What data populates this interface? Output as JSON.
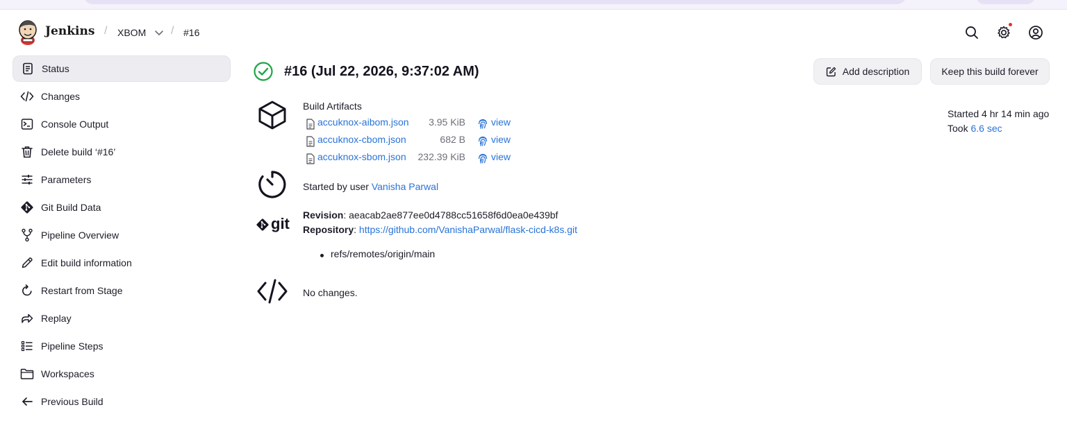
{
  "header": {
    "app_name": "Jenkins",
    "breadcrumbs": [
      "XBOM",
      "#16"
    ],
    "separators": [
      "/",
      "/"
    ],
    "icons": [
      "search-icon",
      "gear-icon",
      "user-icon"
    ],
    "notification_color": "#e5312c"
  },
  "sidebar": {
    "items": [
      {
        "label": "Status",
        "icon": "status-icon"
      },
      {
        "label": "Changes",
        "icon": "code-icon"
      },
      {
        "label": "Console Output",
        "icon": "terminal-icon"
      },
      {
        "label": "Delete build ‘#16’",
        "icon": "trash-icon"
      },
      {
        "label": "Parameters",
        "icon": "sliders-icon"
      },
      {
        "label": "Git Build Data",
        "icon": "git-icon"
      },
      {
        "label": "Pipeline Overview",
        "icon": "pipeline-icon"
      },
      {
        "label": "Edit build information",
        "icon": "pencil-icon"
      },
      {
        "label": "Restart from Stage",
        "icon": "restart-icon"
      },
      {
        "label": "Replay",
        "icon": "replay-icon"
      },
      {
        "label": "Pipeline Steps",
        "icon": "steps-icon"
      },
      {
        "label": "Workspaces",
        "icon": "folder-icon"
      },
      {
        "label": "Previous Build",
        "icon": "arrow-left-icon"
      }
    ]
  },
  "build": {
    "title": "#16 (Jul 22, 2026, 9:37:02 AM)",
    "status_color": "#1ea446",
    "add_description_label": "Add description",
    "keep_forever_label": "Keep this build forever",
    "started_ago": "Started 4 hr 14 min ago",
    "took_label": "Took",
    "took_value": "6.6 sec"
  },
  "artifacts": {
    "heading": "Build Artifacts",
    "files": [
      {
        "name": "accuknox-aibom.json",
        "size": "3.95 KiB",
        "view": "view"
      },
      {
        "name": "accuknox-cbom.json",
        "size": "682 B",
        "view": "view"
      },
      {
        "name": "accuknox-sbom.json",
        "size": "232.39 KiB",
        "view": "view"
      }
    ]
  },
  "started_by": {
    "prefix": "Started by user",
    "user": "Vanisha Parwal"
  },
  "git": {
    "logo_text": "git",
    "revision_label": "Revision",
    "revision_value": "aeacab2ae877ee0d4788cc51658f6d0ea0e439bf",
    "repository_label": "Repository",
    "repository_url": "https://github.com/VanishaParwal/flask-cicd-k8s.git",
    "branch": "refs/remotes/origin/main"
  },
  "changes": {
    "text": "No changes."
  }
}
